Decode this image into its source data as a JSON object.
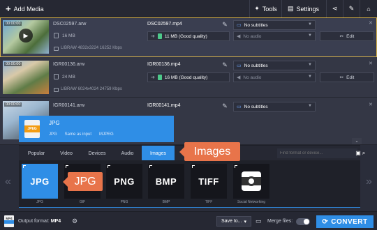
{
  "toolbar": {
    "add_media_label": "Add Media",
    "tools_label": "Tools",
    "settings_label": "Settings"
  },
  "files": [
    {
      "duration": "00:00:00",
      "name": "DSC02597.arw",
      "size": "16 MB",
      "meta": "LIBRAW 4832x3224 16252 Kbps",
      "output_name": "DSC02597.mp4",
      "quality": "11 MB (Good quality)",
      "subtitles": "No subtitles",
      "audio": "No audio",
      "edit_label": "Edit",
      "selected": true
    },
    {
      "duration": "00:00:00",
      "name": "IGR00136.arw",
      "size": "24 MB",
      "meta": "LIBRAW 6024x4024 24759 Kbps",
      "output_name": "IGR00136.mp4",
      "quality": "16 MB (Good quality)",
      "subtitles": "No subtitles",
      "audio": "No audio",
      "edit_label": "Edit",
      "selected": false
    },
    {
      "duration": "00:00:00",
      "name": "IGR00141.arw",
      "size": "",
      "meta": "",
      "output_name": "IGR00141.mp4",
      "quality": "",
      "subtitles": "No subtitles",
      "audio": "",
      "edit_label": "",
      "selected": false
    }
  ],
  "preview": {
    "icon_text": "JPEG",
    "title": "JPG",
    "details": [
      "JPG",
      "Same as input",
      "MJPEG"
    ]
  },
  "format_panel": {
    "tabs": [
      "Popular",
      "Video",
      "Devices",
      "Audio",
      "Images"
    ],
    "active_tab": "Images",
    "search_placeholder": "Find format or device...",
    "formats": [
      {
        "label": "JPG",
        "tile": "JPG"
      },
      {
        "label": "GIF",
        "tile": "GIF"
      },
      {
        "label": "PNG",
        "tile": "PNG"
      },
      {
        "label": "BMP",
        "tile": "BMP"
      },
      {
        "label": "TIFF",
        "tile": "TIFF"
      },
      {
        "label": "Social Networking",
        "tile": ""
      }
    ],
    "selected_format": "JPG"
  },
  "callouts": {
    "images": "Images",
    "jpg": "JPG"
  },
  "bottom": {
    "icon_text": "MP4",
    "output_format_label": "Output format:",
    "output_format_value": "MP4",
    "save_to_label": "Save to...",
    "merge_label": "Merge files:",
    "merge_on": false,
    "convert_label": "CONVERT"
  },
  "colors": {
    "accent": "#2f8ee6",
    "callout": "#e8744a",
    "selection_border": "#d8b34a"
  }
}
